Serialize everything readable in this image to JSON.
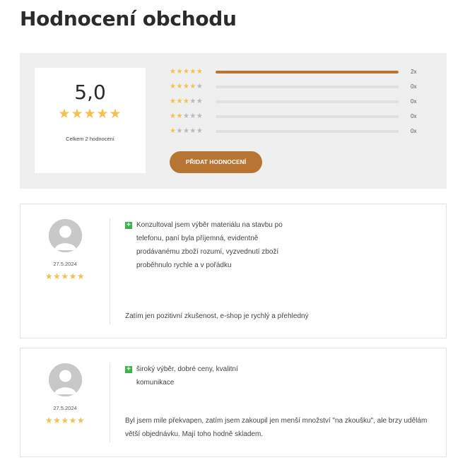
{
  "page": {
    "title": "Hodnocení obchodu"
  },
  "summary": {
    "average": "5,0",
    "stars": "★★★★★",
    "total_label": "Celkem 2 hodnocení",
    "add_button": "PŘIDAT HODNOCENÍ",
    "distribution": [
      {
        "stars": 5,
        "count": "2x",
        "fraction": 1.0
      },
      {
        "stars": 4,
        "count": "0x",
        "fraction": 0
      },
      {
        "stars": 3,
        "count": "0x",
        "fraction": 0
      },
      {
        "stars": 2,
        "count": "0x",
        "fraction": 0
      },
      {
        "stars": 1,
        "count": "0x",
        "fraction": 0
      }
    ]
  },
  "colors": {
    "accent": "#b87432",
    "star": "#f2c14e",
    "star_off": "#b9b9b9",
    "pro_badge": "#3bb54a",
    "panel_bg": "#efefef"
  },
  "reviews": [
    {
      "date": "27.5.2024",
      "stars": "★★★★★",
      "pro_icon": "+",
      "pros": "Konzultoval jsem výběr materiálu na stavbu po telefonu, paní byla příjemná, evidentně prodávanému zboží rozumí, vyzvednutí zboží proběhnulo rychle a v pořádku",
      "text": "Zatím jen pozitivní zkušenost, e-shop je rychlý a přehledný"
    },
    {
      "date": "27.5.2024",
      "stars": "★★★★★",
      "pro_icon": "+",
      "pros": "široký výběr, dobré ceny, kvalitní komunikace",
      "text": "Byl jsem mile překvapen, zatím jsem zakoupil jen menší množství \"na zkoušku\", ale brzy udělám větší objednávku. Mají toho hodně skladem."
    }
  ]
}
